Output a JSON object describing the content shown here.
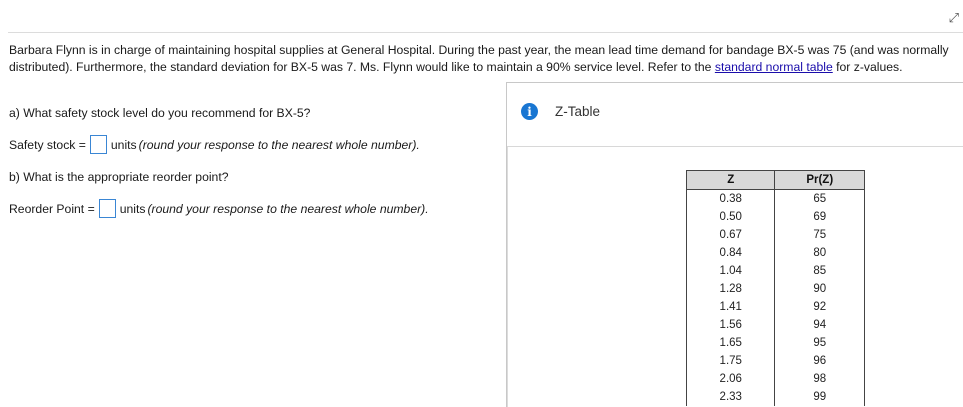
{
  "corner_icon": "resize-icon",
  "problem": {
    "text_before_link": "Barbara Flynn is in charge of maintaining hospital supplies at General Hospital. During the past year, the mean lead time demand for bandage BX-5 was 75 (and was normally distributed). Furthermore, the standard deviation for BX-5 was 7. Ms. Flynn would like to maintain a 90% service level. Refer to the ",
    "link_text": "standard normal table",
    "text_after_link": " for z-values."
  },
  "question_a": {
    "prompt": "a) What safety stock level do you recommend for BX-5?",
    "label": "Safety stock =",
    "value": "",
    "hint_prefix": "units",
    "hint": "(round your response to the nearest whole number)."
  },
  "question_b": {
    "prompt": "b) What is the appropriate reorder point?",
    "label": "Reorder Point =",
    "value": "",
    "hint_prefix": "units",
    "hint": "(round your response to the nearest whole number)."
  },
  "panel": {
    "icon": "info-icon",
    "icon_glyph": "i",
    "title": "Z-Table"
  },
  "ztable": {
    "headers": [
      "Z",
      "Pr(Z)"
    ],
    "rows": [
      [
        "0.38",
        "65"
      ],
      [
        "0.50",
        "69"
      ],
      [
        "0.67",
        "75"
      ],
      [
        "0.84",
        "80"
      ],
      [
        "1.04",
        "85"
      ],
      [
        "1.28",
        "90"
      ],
      [
        "1.41",
        "92"
      ],
      [
        "1.56",
        "94"
      ],
      [
        "1.65",
        "95"
      ],
      [
        "1.75",
        "96"
      ],
      [
        "2.06",
        "98"
      ],
      [
        "2.33",
        "99"
      ]
    ]
  }
}
